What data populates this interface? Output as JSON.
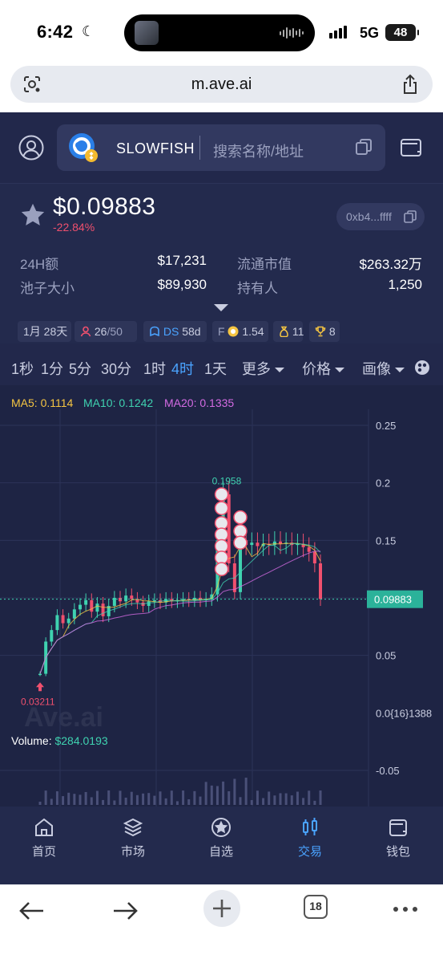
{
  "status_bar": {
    "time": "6:42",
    "network": "5G",
    "battery": "48"
  },
  "browser": {
    "url": "m.ave.ai",
    "open_tabs": "18"
  },
  "header": {
    "token_name": "SLOWFISH",
    "search_placeholder": "搜索名称/地址"
  },
  "token": {
    "price": "$0.09883",
    "change": "-22.84%",
    "address": "0xb4...ffff"
  },
  "stats": {
    "volume_24h_label": "24H额",
    "volume_24h": "$17,231",
    "circ_mcap_label": "流通市值",
    "circ_mcap": "$263.32万",
    "pool_label": "池子大小",
    "pool": "$89,930",
    "holders_label": "持有人",
    "holders": "1,250"
  },
  "tags": {
    "age": "1月 28天",
    "holders_top": "26",
    "holders_total": "/50",
    "ds": "DS",
    "ds_days": "58d",
    "f": "F",
    "f_score": "1.54",
    "snipers": "11",
    "trophy": "8"
  },
  "timeframes": [
    "1秒",
    "1分",
    "5分",
    "30分",
    "1时",
    "4时",
    "1天"
  ],
  "active_timeframe": "4时",
  "toolbar": {
    "more": "更多",
    "price": "价格",
    "draw": "画像"
  },
  "chart_data": {
    "type": "candlestick",
    "ma": [
      {
        "name": "MA5",
        "value": "0.1114",
        "color": "#f5c542"
      },
      {
        "name": "MA10",
        "value": "0.1242",
        "color": "#3fd2b0"
      },
      {
        "name": "MA20",
        "value": "0.1335",
        "color": "#d46be3"
      }
    ],
    "y_ticks": [
      "0.25",
      "0.2",
      "0.15",
      "0.0{16}1388",
      "0.05",
      "-0.05"
    ],
    "y_range": [
      -0.05,
      0.25
    ],
    "current_price_label": "0.09883",
    "current_price": 0.09883,
    "high_label": "0.1958",
    "high": 0.1958,
    "low_label": "0.03211",
    "low": 0.03211,
    "volume_label": "Volume:",
    "volume_value": "$284.0193",
    "watermark": "Ave.ai",
    "price_path": [
      0.034,
      0.062,
      0.072,
      0.085,
      0.078,
      0.082,
      0.09,
      0.094,
      0.098,
      0.088,
      0.095,
      0.084,
      0.093,
      0.1,
      0.097,
      0.102,
      0.099,
      0.096,
      0.093,
      0.097,
      0.098,
      0.096,
      0.099,
      0.097,
      0.098,
      0.099,
      0.098,
      0.1,
      0.098,
      0.099,
      0.103,
      0.15,
      0.19,
      0.13,
      0.105,
      0.15,
      0.146,
      0.148,
      0.145,
      0.147,
      0.146,
      0.149,
      0.147,
      0.148,
      0.146,
      0.147,
      0.144,
      0.14,
      0.13,
      0.099
    ]
  },
  "tabs": [
    {
      "label": "首页",
      "icon": "home-icon"
    },
    {
      "label": "市场",
      "icon": "layers-icon"
    },
    {
      "label": "自选",
      "icon": "star-icon"
    },
    {
      "label": "交易",
      "icon": "candles-icon"
    },
    {
      "label": "钱包",
      "icon": "wallet-icon"
    }
  ],
  "active_tab": "交易",
  "colors": {
    "bg": "#22284b",
    "accent": "#4aa3ff",
    "up": "#3fd2b0",
    "down": "#f0506e"
  }
}
